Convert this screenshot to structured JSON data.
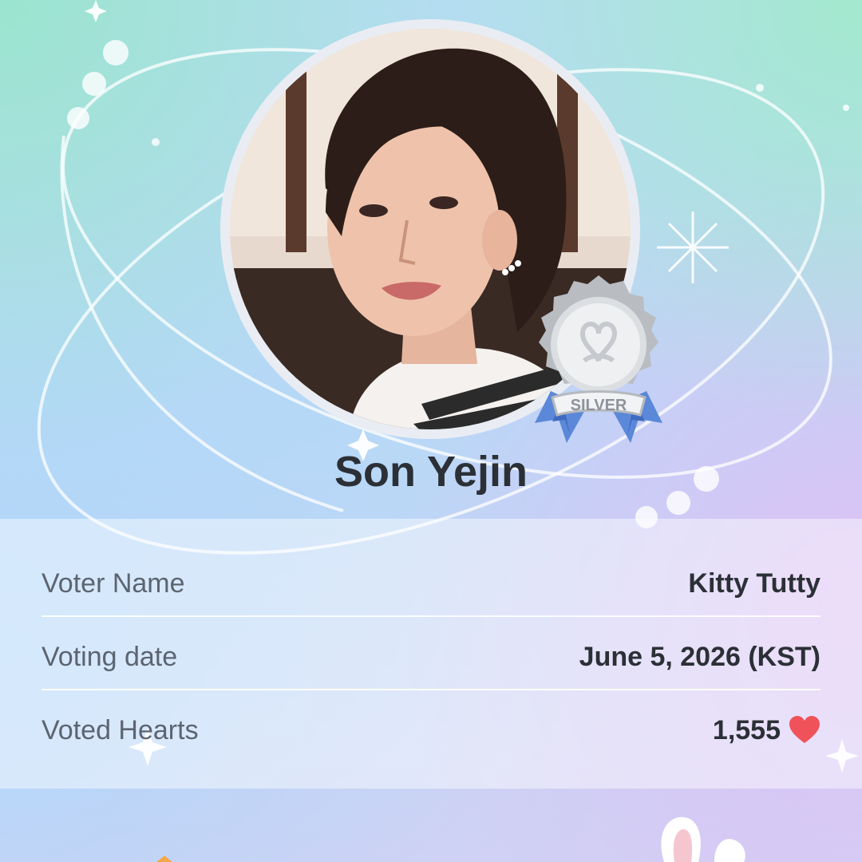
{
  "idol": {
    "name": "Son Yejin",
    "badge_label": "SILVER"
  },
  "details": [
    {
      "label": "Voter Name",
      "value": "Kitty Tutty"
    },
    {
      "label": "Voting date",
      "value": "June 5, 2026 (KST)"
    },
    {
      "label": "Voted Hearts",
      "value": "1,555"
    }
  ],
  "colors": {
    "heart": "#f0525a",
    "badge_ribbon": "#5b88d8",
    "badge_silver": "#c9ccd0"
  },
  "icons": [
    "moon-icon",
    "sparkle-icon",
    "heart-icon",
    "silver-medal-icon",
    "bunny-ears-icon"
  ]
}
